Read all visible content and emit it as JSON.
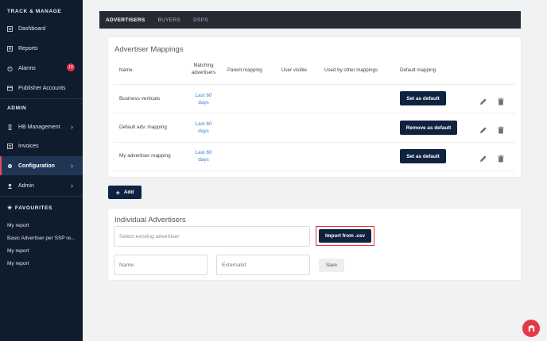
{
  "sidebar": {
    "section_track": "TRACK & MANAGE",
    "items_track": [
      {
        "label": "Dashboard",
        "icon": "dashboard-icon"
      },
      {
        "label": "Reports",
        "icon": "reports-icon"
      },
      {
        "label": "Alarms",
        "icon": "alarm-icon",
        "badge": "10"
      },
      {
        "label": "Publisher Accounts",
        "icon": "publisher-icon"
      }
    ],
    "section_admin": "ADMIN",
    "items_admin": [
      {
        "label": "HB Management",
        "icon": "hb-icon"
      },
      {
        "label": "Invoices",
        "icon": "invoice-icon"
      },
      {
        "label": "Configuration",
        "icon": "gear-icon"
      },
      {
        "label": "Admin",
        "icon": "admin-icon"
      }
    ],
    "section_fav": "FAVOURITES",
    "favourites": [
      "My report",
      "Basic Advertiser per SSP re...",
      "My report",
      "My report"
    ]
  },
  "tabs": [
    "ADVERTISERS",
    "BUYERS",
    "DSPS"
  ],
  "mappings": {
    "title": "Advertiser Mappings",
    "headers": {
      "name": "Name",
      "matching": "Matching advertisers",
      "parent": "Parent mapping",
      "visible": "User visible",
      "used": "Used by other mappings",
      "default": "Default mapping"
    },
    "rows": [
      {
        "name": "Business verticals",
        "link": "Last 60 days",
        "action": "Set as default"
      },
      {
        "name": "Default adv. mapping",
        "link": "Last 60 days",
        "action": "Remove as default"
      },
      {
        "name": "My advertiser mapping",
        "link": "Last 60 days",
        "action": "Set as default"
      }
    ]
  },
  "add_button": "Add",
  "individual": {
    "title": "Individual Advertisers",
    "select_placeholder": "Select existing advertiser",
    "import_label": "Import from .csv",
    "name_placeholder": "Name",
    "external_placeholder": "ExternalId",
    "save_label": "Save"
  },
  "colors": {
    "sidebar_bg": "#0f1c2e",
    "accent_dark": "#0f2340",
    "link": "#3b82d6",
    "highlight": "#e0342f"
  }
}
